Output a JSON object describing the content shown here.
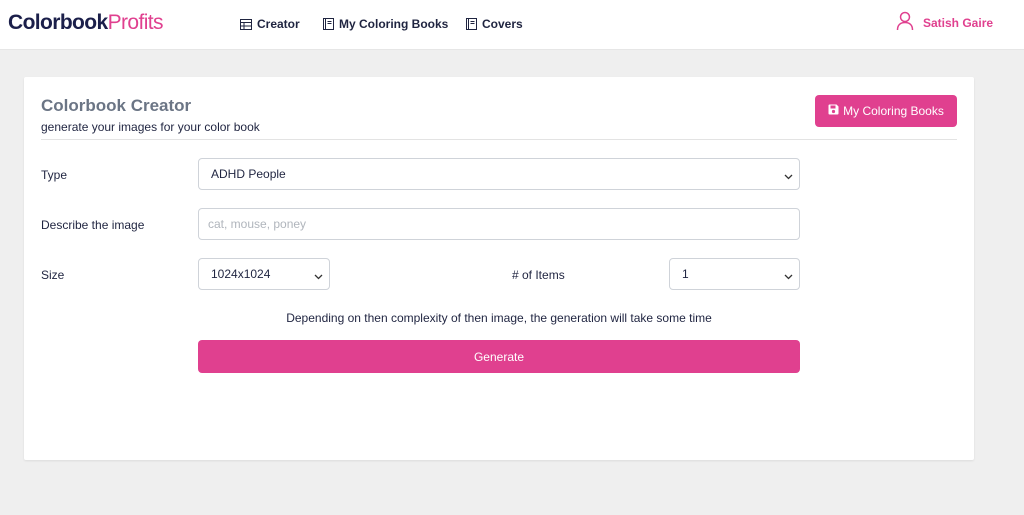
{
  "brand": {
    "part1": "Colorbook",
    "part2": "Profits"
  },
  "nav": {
    "items": [
      {
        "label": "Creator",
        "icon": "table-icon"
      },
      {
        "label": "My Coloring Books",
        "icon": "book-icon"
      },
      {
        "label": "Covers",
        "icon": "book-icon"
      }
    ]
  },
  "user": {
    "name": "Satish Gaire",
    "icon": "user-icon"
  },
  "page": {
    "title": "Colorbook Creator",
    "subtitle": "generate your images for your color book",
    "header_button": "My Coloring Books",
    "header_button_icon": "save-icon"
  },
  "form": {
    "type": {
      "label": "Type",
      "value": "ADHD People"
    },
    "describe": {
      "label": "Describe the image",
      "value": "",
      "placeholder": "cat, mouse, poney"
    },
    "size": {
      "label": "Size",
      "value": "1024x1024"
    },
    "items": {
      "label": "# of Items",
      "value": "1"
    },
    "note": "Depending on then complexity of then image, the generation will take some time",
    "generate": "Generate"
  },
  "colors": {
    "accent": "#e0408f",
    "brand_dark": "#1b1f4a",
    "background": "#efefef",
    "title_gray": "#6b7585"
  }
}
